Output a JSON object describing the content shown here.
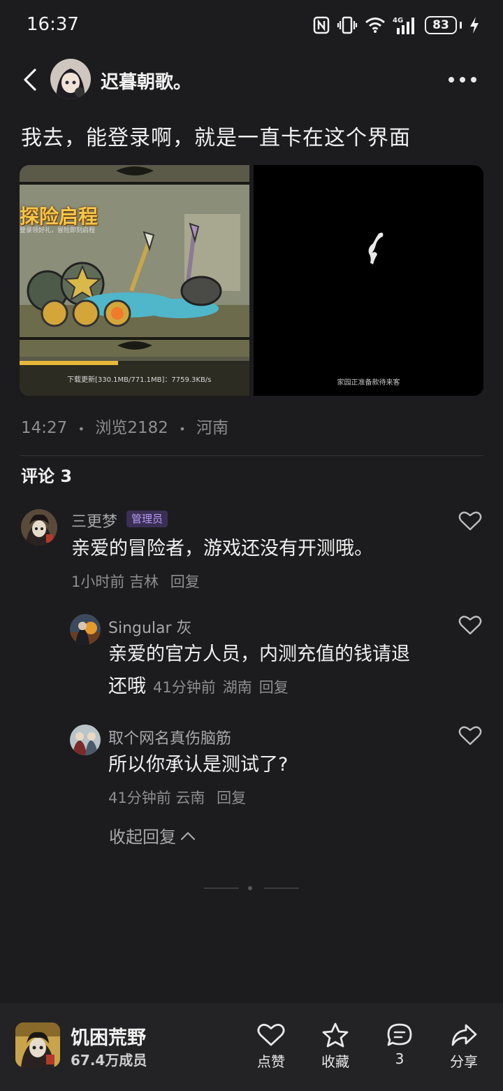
{
  "status_bar": {
    "time": "16:37",
    "network": "4G",
    "battery": "83",
    "icons": [
      "nfc-icon",
      "vibrate-icon",
      "wifi-icon",
      "signal-icon",
      "battery-icon",
      "charging-icon"
    ]
  },
  "header": {
    "author_name": "迟暮朝歌。",
    "back_icon": "chevron-left-icon",
    "more_icon": "more-horizontal-icon"
  },
  "post": {
    "text": "我去，能登录啊，就是一直卡在这个界面",
    "media": {
      "left": {
        "banner": "探险启程",
        "subtitle": "登录领好礼，冒险即刻启程",
        "loading_text": "下载更新[330.1MB/771.1MB]：7759.3KB/s",
        "progress": 0.43
      },
      "right": {
        "waiting_text": "家园正准备款待来客"
      }
    },
    "time": "14:27",
    "views": "浏览2182",
    "location": "河南",
    "separator": "•"
  },
  "comments": {
    "title": "评论 3",
    "items": [
      {
        "name": "三更梦",
        "badge": "管理员",
        "text": "亲爱的冒险者，游戏还没有开测哦。",
        "time": "1小时前",
        "location": "吉林",
        "reply": "回复"
      }
    ],
    "replies": [
      {
        "name": "Singular 灰",
        "text_line1": "亲爱的官方人员，内测充值的钱请退",
        "text_line2": "还哦",
        "time": "41分钟前",
        "location": "湖南",
        "reply": "回复"
      },
      {
        "name": "取个网名真伤脑筋",
        "text": "所以你承认是测试了?",
        "time": "41分钟前",
        "location": "云南",
        "reply": "回复"
      }
    ],
    "collapse_label": "收起回复"
  },
  "bottom_bar": {
    "game_name": "饥困荒野",
    "members": "67.4万成员",
    "actions": [
      {
        "label": "点赞",
        "icon": "heart-icon"
      },
      {
        "label": "收藏",
        "icon": "star-icon"
      },
      {
        "label": "3",
        "icon": "comment-icon"
      },
      {
        "label": "分享",
        "icon": "share-icon"
      }
    ]
  },
  "colors": {
    "background": "#1c1c1e",
    "bottom_bar": "#232325",
    "badge_bg": "#3b2f55",
    "badge_text": "#b79bf0",
    "muted_text": "#8e8e92"
  }
}
